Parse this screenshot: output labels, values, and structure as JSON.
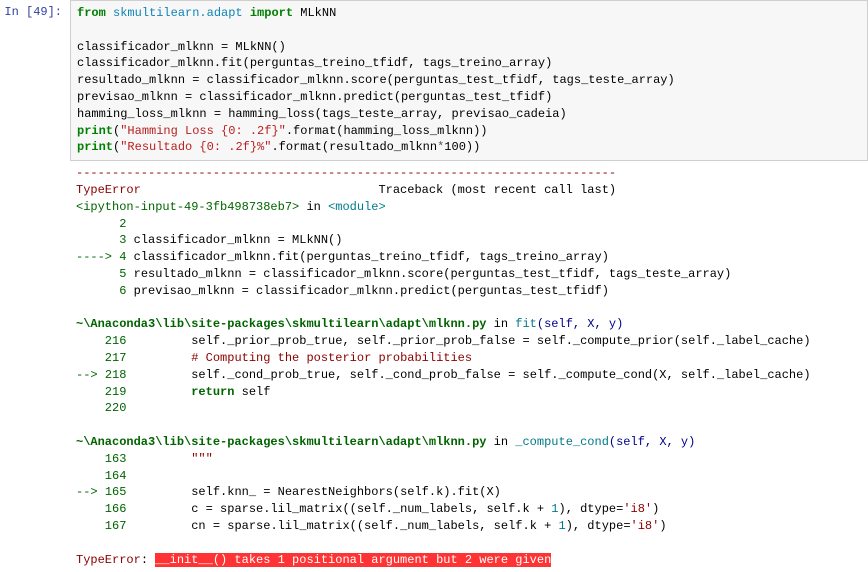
{
  "cell": {
    "prompt_label": "In [49]:",
    "code": {
      "l1_kw_from": "from",
      "l1_mod": "skmultilearn.adapt",
      "l1_kw_import": "import",
      "l1_name": "MLkNN",
      "l3": "classificador_mlknn = MLkNN()",
      "l4": "classificador_mlknn.fit(perguntas_treino_tfidf, tags_treino_array)",
      "l5": "resultado_mlknn = classificador_mlknn.score(perguntas_test_tfidf, tags_teste_array)",
      "l6": "previsao_mlknn = classificador_mlknn.predict(perguntas_test_tfidf)",
      "l7": "hamming_loss_mlknn = hamming_loss(tags_teste_array, previsao_cadeia)",
      "l8_print": "print",
      "l8_str": "\"Hamming Loss {0: .2f}\"",
      "l8_rest": ".format(hamming_loss_mlknn))",
      "l9_print": "print",
      "l9_str": "\"Resultado {0: .2f}%\"",
      "l9_rest1": ".format(resultado_mlknn",
      "l9_op": "*",
      "l9_num": "100",
      "l9_rest2": "))"
    }
  },
  "tb": {
    "sep": "---------------------------------------------------------------------------",
    "err_name": "TypeError",
    "header_rest": "                                 Traceback (most recent call last)",
    "frame1_loc": "<ipython-input-49-3fb498738eb7>",
    "frame1_in": " in ",
    "frame1_mod": "<module>",
    "f1_ln2": "      2",
    "f1_ln2_code": " ",
    "f1_ln3": "      3",
    "f1_ln3_code": " classificador_mlknn = MLkNN()",
    "f1_arrow": "----> ",
    "f1_ln4": "4",
    "f1_ln4_code": " classificador_mlknn.fit(perguntas_treino_tfidf, tags_treino_array)",
    "f1_ln5": "      5",
    "f1_ln5_code": " resultado_mlknn = classificador_mlknn.score(perguntas_test_tfidf, tags_teste_array)",
    "f1_ln6": "      6",
    "f1_ln6_code": " previsao_mlknn = classificador_mlknn.predict(perguntas_test_tfidf)",
    "frame2_path": "~\\Anaconda3\\lib\\site-packages\\skmultilearn\\adapt\\mlknn.py",
    "frame2_in": " in ",
    "frame2_fn": "fit",
    "frame2_args": "(self, X, y)",
    "f2_ln216": "    216",
    "f2_ln216_code": "         self._prior_prob_true, self._prior_prob_false = self._compute_prior(self._label_cache)",
    "f2_ln217": "    217",
    "f2_ln217_code": "         ",
    "f2_ln217_cm": "# Computing the posterior probabilities",
    "f2_arrow": "--> ",
    "f2_ln218": "218",
    "f2_ln218_code": "         self._cond_prob_true, self._cond_prob_false = self._compute_cond(X, self._label_cache)",
    "f2_ln219": "    219",
    "f2_ln219_code": "         ",
    "f2_ln219_kw": "return",
    "f2_ln219_rest": " self",
    "f2_ln220": "    220",
    "f2_ln220_code": " ",
    "frame3_path": "~\\Anaconda3\\lib\\site-packages\\skmultilearn\\adapt\\mlknn.py",
    "frame3_in": " in ",
    "frame3_fn": "_compute_cond",
    "frame3_args": "(self, X, y)",
    "f3_ln163": "    163",
    "f3_ln163_code": "         ",
    "f3_ln163_str": "\"\"\"",
    "f3_ln164": "    164",
    "f3_ln164_code": " ",
    "f3_arrow": "--> ",
    "f3_ln165": "165",
    "f3_ln165_code": "         self.knn_ = NearestNeighbors(self.k).fit(X)",
    "f3_ln166": "    166",
    "f3_ln166_code": "         c = sparse.lil_matrix((self._num_labels, self.k + ",
    "f3_ln166_num": "1",
    "f3_ln166_mid": "), dtype=",
    "f3_ln166_str": "'i8'",
    "f3_ln166_end": ")",
    "f3_ln167": "    167",
    "f3_ln167_code": "         cn = sparse.lil_matrix((self._num_labels, self.k + ",
    "f3_ln167_num": "1",
    "f3_ln167_mid": "), dtype=",
    "f3_ln167_str": "'i8'",
    "f3_ln167_end": ")",
    "final_err": "TypeError",
    "final_colon": ": ",
    "final_msg": "__init__() takes 1 positional argument but 2 were given"
  }
}
